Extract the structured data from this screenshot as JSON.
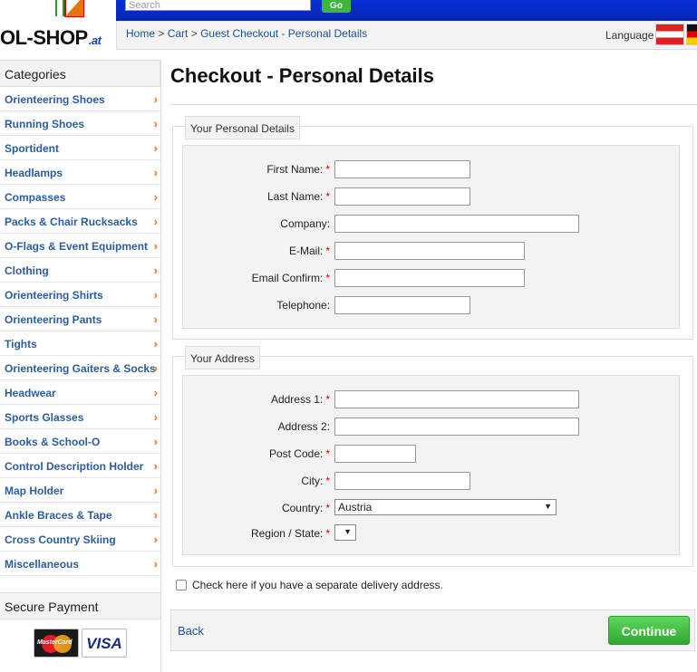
{
  "header": {
    "logo_text": "OL-SHOP",
    "logo_tld": ".at",
    "search_placeholder": "Search",
    "go_label": "Go",
    "language_label": "Language"
  },
  "breadcrumb": [
    {
      "label": "Home"
    },
    {
      "label": "Cart"
    },
    {
      "label": "Guest Checkout - Personal Details"
    }
  ],
  "breadcrumb_separator": ">",
  "sidebar": {
    "categories_title": "Categories",
    "secure_title": "Secure Payment",
    "items": [
      "Orienteering Shoes",
      "Running Shoes",
      "Sportident",
      "Headlamps",
      "Compasses",
      "Packs & Chair Rucksacks",
      "O-Flags & Event Equipment",
      "Clothing",
      "Orienteering Shirts",
      "Orienteering Pants",
      "Tights",
      "Orienteering Gaiters & Socks",
      "Headwear",
      "Sports Glasses",
      "Books & School-O",
      "Control Description Holder",
      "Map Holder",
      "Ankle Braces & Tape",
      "Cross Country Skiing",
      "Miscellaneous"
    ],
    "payment": {
      "mastercard": "MasterCard",
      "visa": "VISA"
    }
  },
  "main": {
    "title": "Checkout - Personal Details",
    "personal": {
      "legend": "Your Personal Details",
      "fields": [
        {
          "label": "First Name:",
          "required": true,
          "value": ""
        },
        {
          "label": "Last Name:",
          "required": true,
          "value": ""
        },
        {
          "label": "Company:",
          "required": false,
          "value": ""
        },
        {
          "label": "E-Mail:",
          "required": true,
          "value": ""
        },
        {
          "label": "Email Confirm:",
          "required": true,
          "value": ""
        },
        {
          "label": "Telephone:",
          "required": false,
          "value": ""
        }
      ]
    },
    "address": {
      "legend": "Your Address",
      "fields": [
        {
          "label": "Address 1:",
          "required": true,
          "value": ""
        },
        {
          "label": "Address 2:",
          "required": false,
          "value": ""
        },
        {
          "label": "Post Code:",
          "required": true,
          "value": ""
        },
        {
          "label": "City:",
          "required": true,
          "value": ""
        }
      ],
      "country": {
        "label": "Country:",
        "required": true,
        "value": "Austria"
      },
      "region": {
        "label": "Region / State:",
        "required": true,
        "value": ""
      }
    },
    "delivery_checkbox": {
      "label": "Check here if you have a separate delivery address.",
      "checked": false
    },
    "back_label": "Back",
    "continue_label": "Continue"
  },
  "required_marker": "*",
  "colors": {
    "link": "#1d4f9c",
    "category": "#2a5d9f",
    "chevron": "#e8730c",
    "topbar": "#0a2fd6",
    "continue": "#3cb83c",
    "required": "#dd0000"
  }
}
